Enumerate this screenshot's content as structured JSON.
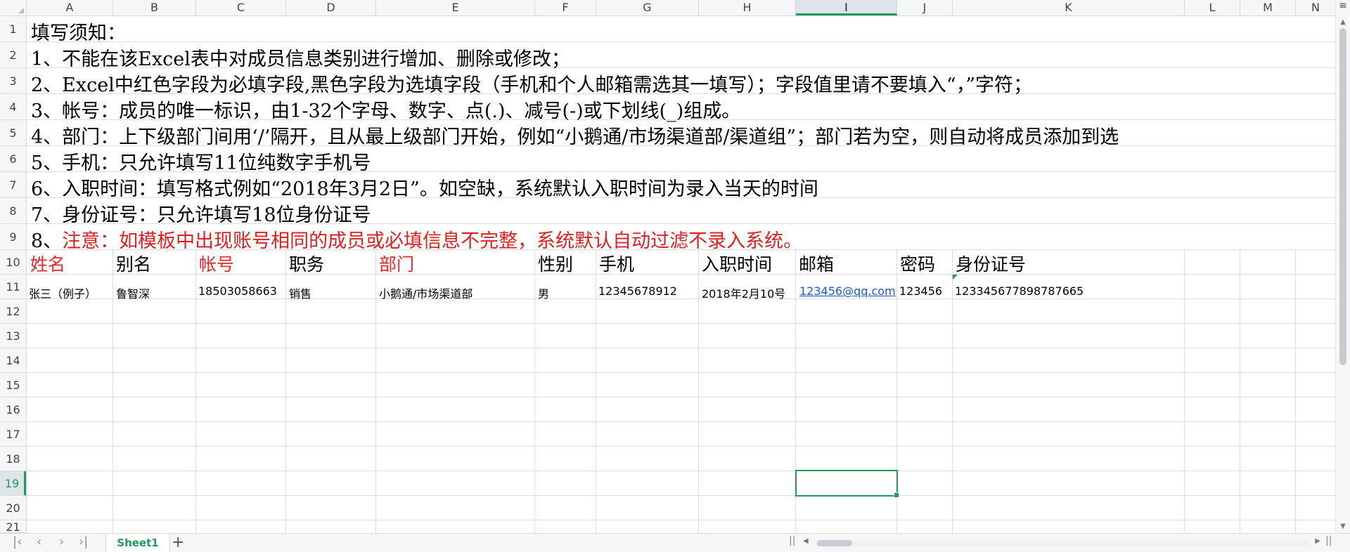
{
  "columns": [
    "A",
    "B",
    "C",
    "D",
    "E",
    "F",
    "G",
    "H",
    "I",
    "J",
    "K",
    "L",
    "M",
    "N"
  ],
  "active_column": "I",
  "rows": [
    "1",
    "2",
    "3",
    "4",
    "5",
    "6",
    "7",
    "8",
    "9",
    "10",
    "11",
    "12",
    "13",
    "14",
    "15",
    "16",
    "17",
    "18",
    "19",
    "20",
    "21"
  ],
  "active_row": "19",
  "instructions": {
    "title": "填写须知：",
    "line1": "1、不能在该Excel表中对成员信息类别进行增加、删除或修改；",
    "line2": "2、Excel中红色字段为必填字段,黑色字段为选填字段（手机和个人邮箱需选其一填写）；字段值里请不要填入“，”字符；",
    "line3": "3、帐号：成员的唯一标识，由1-32个字母、数字、点(.)、减号(-)或下划线(_)组成。",
    "line4": "4、部门：上下级部门间用‘/’隔开，且从最上级部门开始，例如“小鹅通/市场渠道部/渠道组”；部门若为空，则自动将成员添加到选",
    "line5": "5、手机：只允许填写11位纯数字手机号",
    "line6": "6、入职时间：填写格式例如“2018年3月2日”。如空缺，系统默认入职时间为录入当天的时间",
    "line7": "7、身份证号：只允许填写18位身份证号",
    "line8_prefix": "8、",
    "line8_red": "注意：如模板中出现账号相同的成员或必填信息不完整，系统默认自动过滤不录入系统。"
  },
  "headers": {
    "name": "姓名",
    "alias": "别名",
    "account": "帐号",
    "position": "职务",
    "department": "部门",
    "gender": "性别",
    "phone": "手机",
    "hire_date": "入职时间",
    "email": "邮箱",
    "password": "密码",
    "id_number": "身份证号"
  },
  "example": {
    "name": "张三（例子）",
    "alias": "鲁智深",
    "account": "18503058663",
    "position": "销售",
    "department": "小鹅通/市场渠道部",
    "gender": "男",
    "phone": "12345678912",
    "hire_date": "2018年2月10号",
    "email": "123456@qq.com",
    "password": "123456",
    "id_number": "123345677898787665"
  },
  "sheet_tab": "Sheet1",
  "colors": {
    "required": "#e8262a",
    "accent": "#1e9b5a",
    "link": "#1a56db"
  },
  "icons": [
    "first-sheet-icon",
    "prev-sheet-icon",
    "next-sheet-icon",
    "last-sheet-icon",
    "add-sheet-icon",
    "sheet-menu-icon"
  ]
}
